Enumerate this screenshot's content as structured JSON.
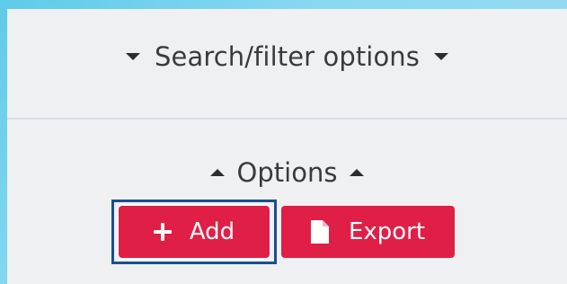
{
  "search_filter": {
    "label": "Search/filter options",
    "left_icon": "caret-down-icon",
    "right_icon": "caret-down-icon"
  },
  "options": {
    "label": "Options",
    "left_icon": "caret-up-icon",
    "right_icon": "caret-up-icon"
  },
  "buttons": {
    "add": {
      "label": "Add",
      "icon": "plus-icon",
      "focused": true
    },
    "export": {
      "label": "Export",
      "icon": "file-icon"
    }
  },
  "colors": {
    "button": "#e01f47",
    "focus_ring": "#1a4f8f",
    "panel": "#eef0f2",
    "backdrop": "#8ad9f2"
  }
}
